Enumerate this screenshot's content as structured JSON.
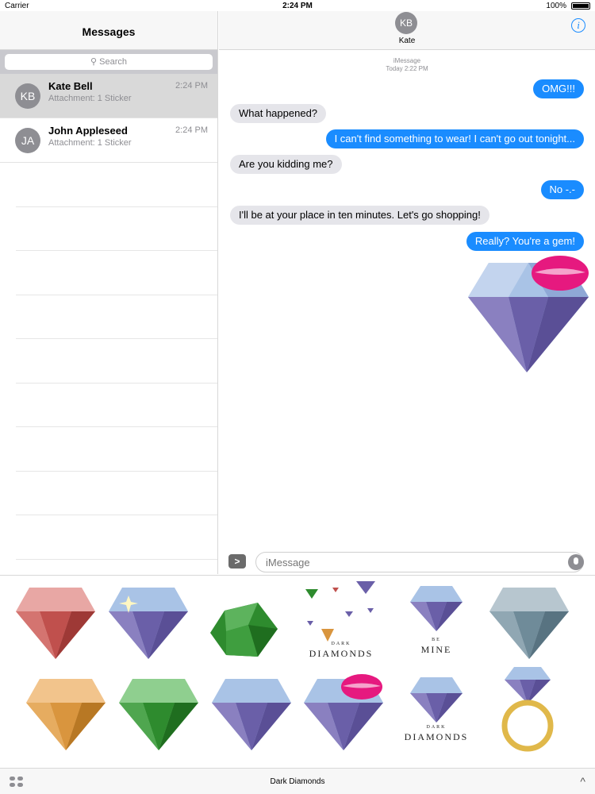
{
  "status_bar": {
    "carrier": "Carrier",
    "time": "2:24 PM",
    "battery": "100%"
  },
  "sidebar": {
    "title": "Messages",
    "search_placeholder": "Search",
    "conversations": [
      {
        "initials": "KB",
        "name": "Kate Bell",
        "preview": "Attachment: 1 Sticker",
        "time": "2:24 PM",
        "selected": true
      },
      {
        "initials": "JA",
        "name": "John Appleseed",
        "preview": "Attachment: 1 Sticker",
        "time": "2:24 PM",
        "selected": false
      }
    ]
  },
  "chat": {
    "contact_initials": "KB",
    "contact_name": "Kate",
    "service": "iMessage",
    "timestamp": "Today 2:22 PM",
    "messages": [
      {
        "dir": "out",
        "text": "OMG!!!"
      },
      {
        "dir": "in",
        "text": "What happened?"
      },
      {
        "dir": "out",
        "text": "I can't find something to wear! I can't go out tonight..."
      },
      {
        "dir": "in",
        "text": "Are you kidding me?"
      },
      {
        "dir": "out",
        "text": "No -.-"
      },
      {
        "dir": "in",
        "text": "I'll be at your place in ten minutes. Let's go shopping!"
      },
      {
        "dir": "out",
        "text": "Really? You're a gem!"
      }
    ],
    "input_placeholder": "iMessage",
    "apps_button": ">"
  },
  "stickers": {
    "labels": {
      "dark_diamonds": "DIAMONDS",
      "dark_small": "DARK",
      "be": "BE",
      "mine": "MINE"
    },
    "colors": {
      "ruby": "#c0504d",
      "sapphire": "#6a5fa8",
      "emerald": "#2e8b2e",
      "topaz": "#d9953e",
      "grey": "#6f8b99",
      "ice": "#a9c3e6",
      "lips": "#e6197f",
      "gold": "#e0b84a"
    }
  },
  "bottom_bar": {
    "title": "Dark Diamonds",
    "chevron": "^"
  }
}
